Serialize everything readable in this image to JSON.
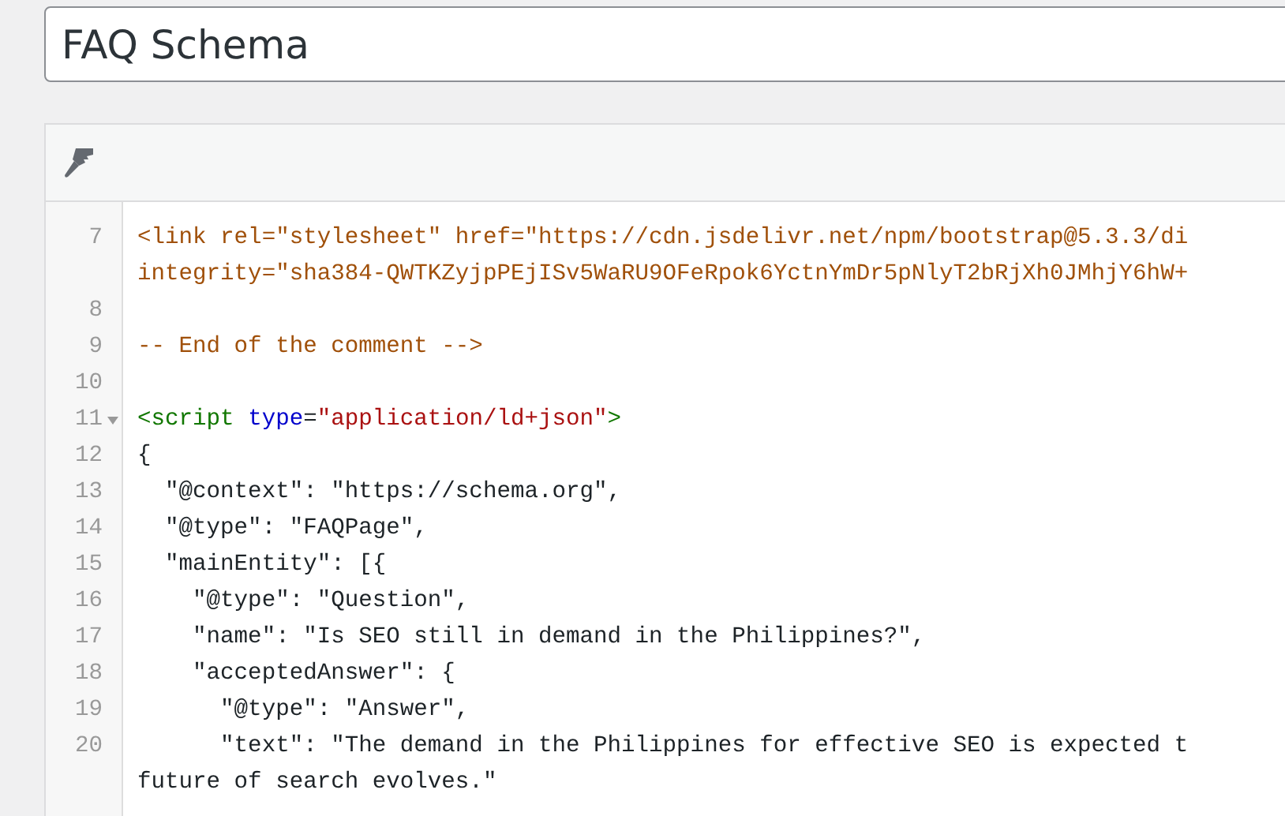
{
  "title_field": {
    "value": "FAQ Schema"
  },
  "code_lines": [
    {
      "number": "7",
      "foldable": false,
      "rows": [
        [
          {
            "kind": "comment",
            "text": "<link rel=\"stylesheet\" href=\"https://cdn.jsdelivr.net/npm/bootstrap@5.3.3/di"
          }
        ],
        [
          {
            "kind": "comment",
            "text": "integrity=\"sha384-QWTKZyjpPEjISv5WaRU9OFeRpok6YctnYmDr5pNlyT2bRjXh0JMhjY6hW+"
          }
        ]
      ]
    },
    {
      "number": "8",
      "foldable": false,
      "rows": [
        []
      ]
    },
    {
      "number": "9",
      "foldable": false,
      "rows": [
        [
          {
            "kind": "comment",
            "text": "-- End of the comment -->"
          }
        ]
      ]
    },
    {
      "number": "10",
      "foldable": false,
      "rows": [
        []
      ]
    },
    {
      "number": "11",
      "foldable": true,
      "rows": [
        [
          {
            "kind": "tag",
            "text": "<script"
          },
          {
            "kind": "plain",
            "text": " "
          },
          {
            "kind": "attribute",
            "text": "type"
          },
          {
            "kind": "plain",
            "text": "="
          },
          {
            "kind": "string",
            "text": "\"application/ld+json\""
          },
          {
            "kind": "tag",
            "text": ">"
          }
        ]
      ]
    },
    {
      "number": "12",
      "foldable": false,
      "rows": [
        [
          {
            "kind": "plain",
            "text": "{"
          }
        ]
      ]
    },
    {
      "number": "13",
      "foldable": false,
      "rows": [
        [
          {
            "kind": "plain",
            "text": "  \"@context\": \"https://schema.org\","
          }
        ]
      ]
    },
    {
      "number": "14",
      "foldable": false,
      "rows": [
        [
          {
            "kind": "plain",
            "text": "  \"@type\": \"FAQPage\","
          }
        ]
      ]
    },
    {
      "number": "15",
      "foldable": false,
      "rows": [
        [
          {
            "kind": "plain",
            "text": "  \"mainEntity\": [{"
          }
        ]
      ]
    },
    {
      "number": "16",
      "foldable": false,
      "rows": [
        [
          {
            "kind": "plain",
            "text": "    \"@type\": \"Question\","
          }
        ]
      ]
    },
    {
      "number": "17",
      "foldable": false,
      "rows": [
        [
          {
            "kind": "plain",
            "text": "    \"name\": \"Is SEO still in demand in the Philippines?\","
          }
        ]
      ]
    },
    {
      "number": "18",
      "foldable": false,
      "rows": [
        [
          {
            "kind": "plain",
            "text": "    \"acceptedAnswer\": {"
          }
        ]
      ]
    },
    {
      "number": "19",
      "foldable": false,
      "rows": [
        [
          {
            "kind": "plain",
            "text": "      \"@type\": \"Answer\","
          }
        ]
      ]
    },
    {
      "number": "20",
      "foldable": false,
      "rows": [
        [
          {
            "kind": "plain",
            "text": "      \"text\": \"The demand in the Philippines for effective SEO is expected t"
          }
        ],
        [
          {
            "kind": "plain",
            "text": "future of search evolves.\""
          }
        ]
      ]
    }
  ]
}
